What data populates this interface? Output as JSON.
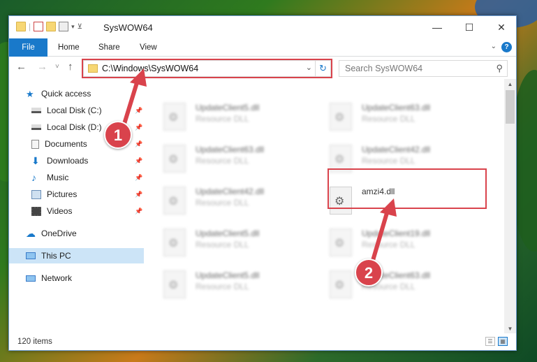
{
  "window": {
    "title": "SysWOW64",
    "controls": {
      "minimize": "—",
      "maximize": "☐",
      "close": "✕"
    }
  },
  "ribbon": {
    "tabs": [
      {
        "label": "File"
      },
      {
        "label": "Home"
      },
      {
        "label": "Share"
      },
      {
        "label": "View"
      }
    ],
    "help": "?"
  },
  "navigation": {
    "back": "←",
    "forward": "→",
    "recent": "˅",
    "up": "↑",
    "address": "C:\\Windows\\SysWOW64",
    "search_placeholder": "Search SysWOW64"
  },
  "sidebar": {
    "items": [
      {
        "label": "Quick access",
        "icon": "star-icon",
        "pinned": false
      },
      {
        "label": "Local Disk (C:)",
        "icon": "drive-icon",
        "pinned": true
      },
      {
        "label": "Local Disk (D:)",
        "icon": "drive-icon",
        "pinned": true
      },
      {
        "label": "Documents",
        "icon": "documents-icon",
        "pinned": true
      },
      {
        "label": "Downloads",
        "icon": "downloads-icon",
        "pinned": true
      },
      {
        "label": "Music",
        "icon": "music-icon",
        "pinned": true
      },
      {
        "label": "Pictures",
        "icon": "pictures-icon",
        "pinned": true
      },
      {
        "label": "Videos",
        "icon": "videos-icon",
        "pinned": true
      },
      {
        "label": "OneDrive",
        "icon": "cloud-icon",
        "pinned": false
      },
      {
        "label": "This PC",
        "icon": "computer-icon",
        "pinned": false,
        "selected": true
      },
      {
        "label": "Network",
        "icon": "network-icon",
        "pinned": false
      }
    ]
  },
  "files": [
    {
      "name": "UpdateClient5.dll",
      "type": "Resource DLL"
    },
    {
      "name": "UpdateClient63.dll",
      "type": "Resource DLL"
    },
    {
      "name": "UpdateClient63.dll",
      "type": "Resource DLL"
    },
    {
      "name": "UpdateClient42.dll",
      "type": "Resource DLL"
    },
    {
      "name": "UpdateClient42.dll",
      "type": "Resource DLL"
    },
    {
      "name": "amzi4.dll",
      "type": ""
    },
    {
      "name": "UpdateClient5.dll",
      "type": "Resource DLL"
    },
    {
      "name": "UpdateClient19.dll",
      "type": "Resource DLL"
    },
    {
      "name": "UpdateClient5.dll",
      "type": "Resource DLL"
    },
    {
      "name": "UpdateClient63.dll",
      "type": "Resource DLL"
    }
  ],
  "status": {
    "item_count": "120 items"
  },
  "annotations": {
    "step1": "1",
    "step2": "2",
    "color": "#d9434c"
  }
}
